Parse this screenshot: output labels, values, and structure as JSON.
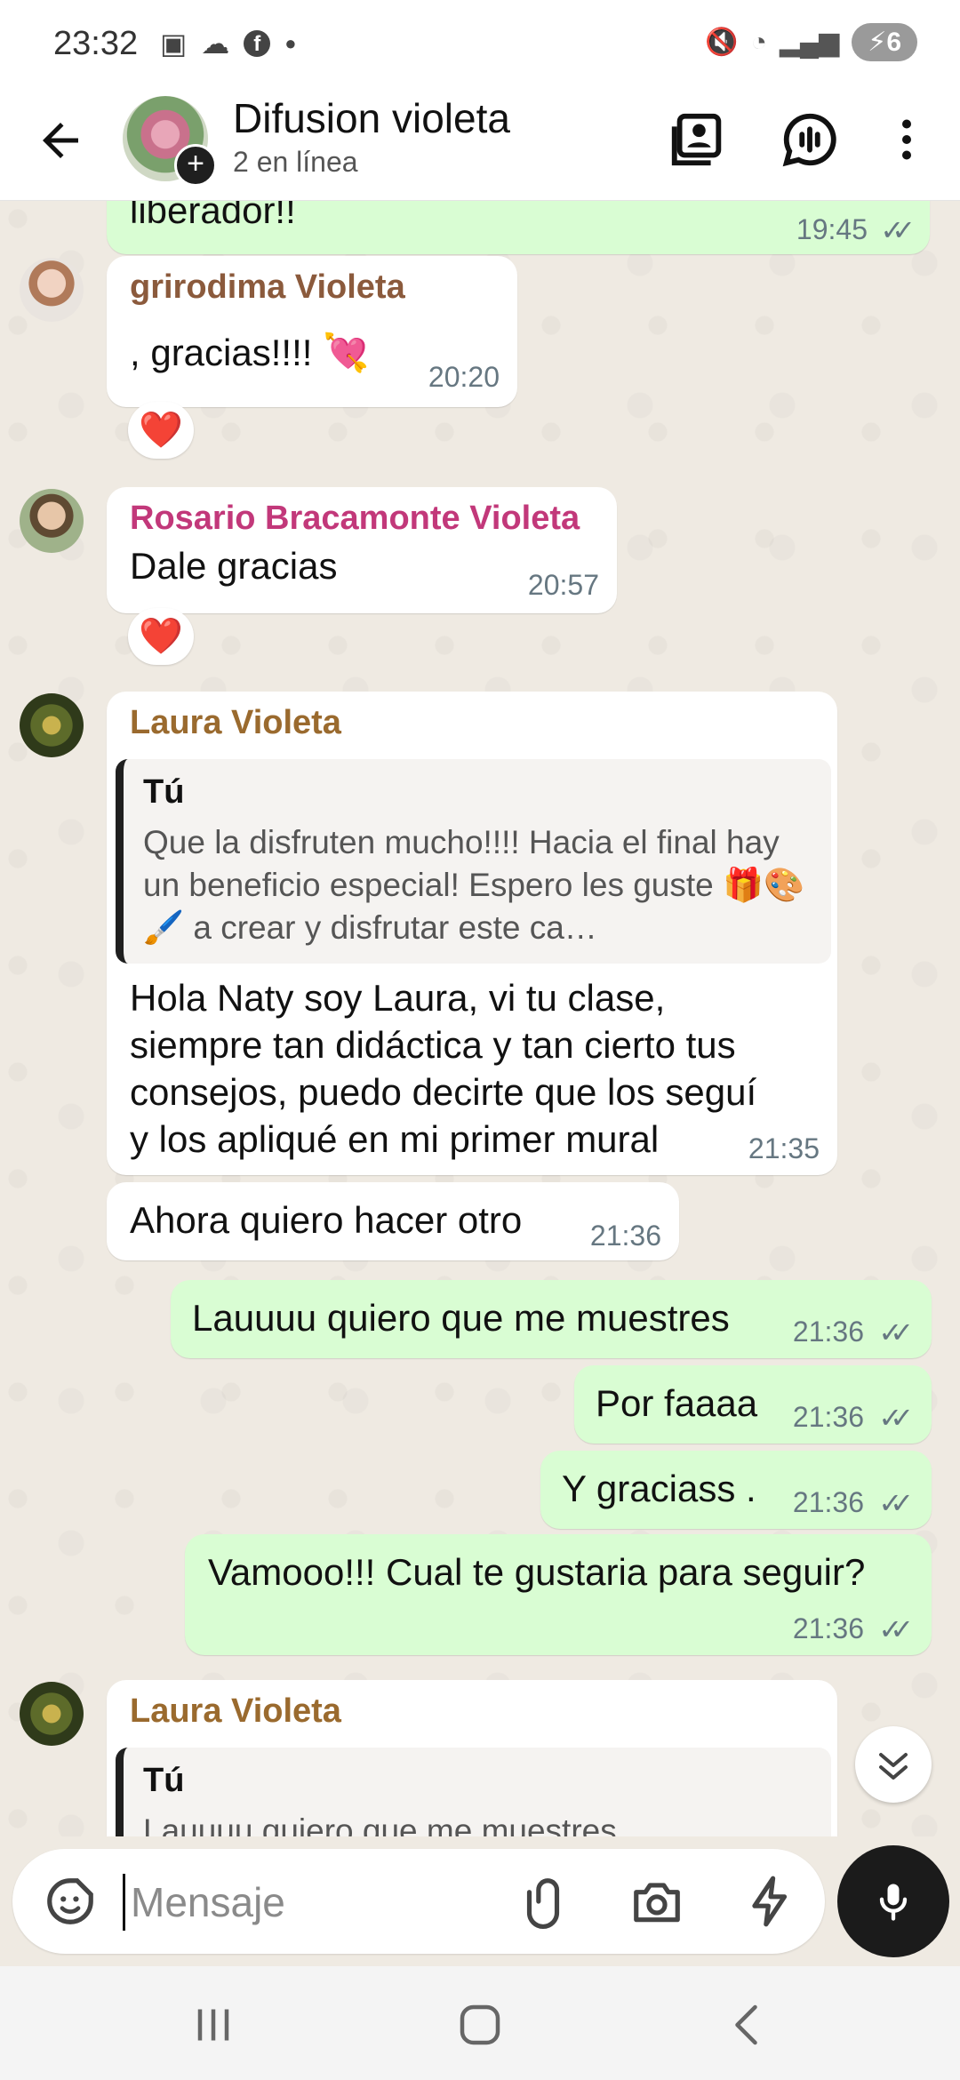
{
  "status_bar": {
    "time": "23:32",
    "battery_level": "6",
    "left_icons": [
      "screenshot-icon",
      "cloud-icon",
      "facebook-icon",
      "dot-icon"
    ],
    "right_icons": [
      "mute-icon",
      "wifi-icon",
      "signal-icon",
      "battery-icon"
    ]
  },
  "header": {
    "title": "Difusion violeta",
    "subtitle": "2 en línea",
    "actions": [
      "contact-card-icon",
      "voice-chat-icon",
      "more-vert-icon"
    ]
  },
  "chat": {
    "top_partial": {
      "text": "liberador!!",
      "time": "19:45"
    },
    "messages": [
      {
        "sender": "grirodima Violeta",
        "sender_color": "#8b5a3c",
        "text": ", gracias!!!! 💘",
        "time": "20:20",
        "reaction": "❤️"
      },
      {
        "sender": "Rosario Bracamonte Violeta",
        "sender_color": "#c2387a",
        "text": "Dale gracias",
        "time": "20:57",
        "reaction": "❤️"
      },
      {
        "sender": "Laura Violeta",
        "sender_color": "#9a6a2e",
        "quote_author": "Tú",
        "quote_text": "Que la disfruten mucho!!!! Hacia el final hay un beneficio especial! Espero les guste 🎁🎨🖌️ a crear y disfrutar este ca…",
        "text": "Hola Naty soy Laura, vi tu clase, siempre tan didáctica y tan cierto tus consejos, puedo decirte que los seguí y los apliqué en mi primer mural",
        "time": "21:35"
      },
      {
        "text": "Ahora quiero hacer otro",
        "time": "21:36"
      },
      {
        "text": "Lauuuu quiero que me muestres",
        "time": "21:36",
        "outgoing": true
      },
      {
        "text": "Por faaaa",
        "time": "21:36",
        "outgoing": true
      },
      {
        "text": "Y graciass .",
        "time": "21:36",
        "outgoing": true
      },
      {
        "text": "Vamooo!!! Cual te gustaria para seguir?",
        "time": "21:36",
        "outgoing": true
      },
      {
        "sender": "Laura Violeta",
        "sender_color": "#9a6a2e",
        "quote_author": "Tú",
        "quote_text": "Lauuuu quiero que me muestres"
      }
    ],
    "ticks": "✓✓"
  },
  "composer": {
    "placeholder": "Mensaje",
    "icons": [
      "sticker-icon",
      "attach-icon",
      "camera-icon",
      "quick-reply-icon",
      "mic-icon"
    ]
  },
  "nav": [
    "recents-icon",
    "home-icon",
    "back-nav-icon"
  ],
  "colors": {
    "outgoing_bubble": "#d9fdd3",
    "incoming_bubble": "#ffffff",
    "chat_bg": "#efeae2"
  }
}
